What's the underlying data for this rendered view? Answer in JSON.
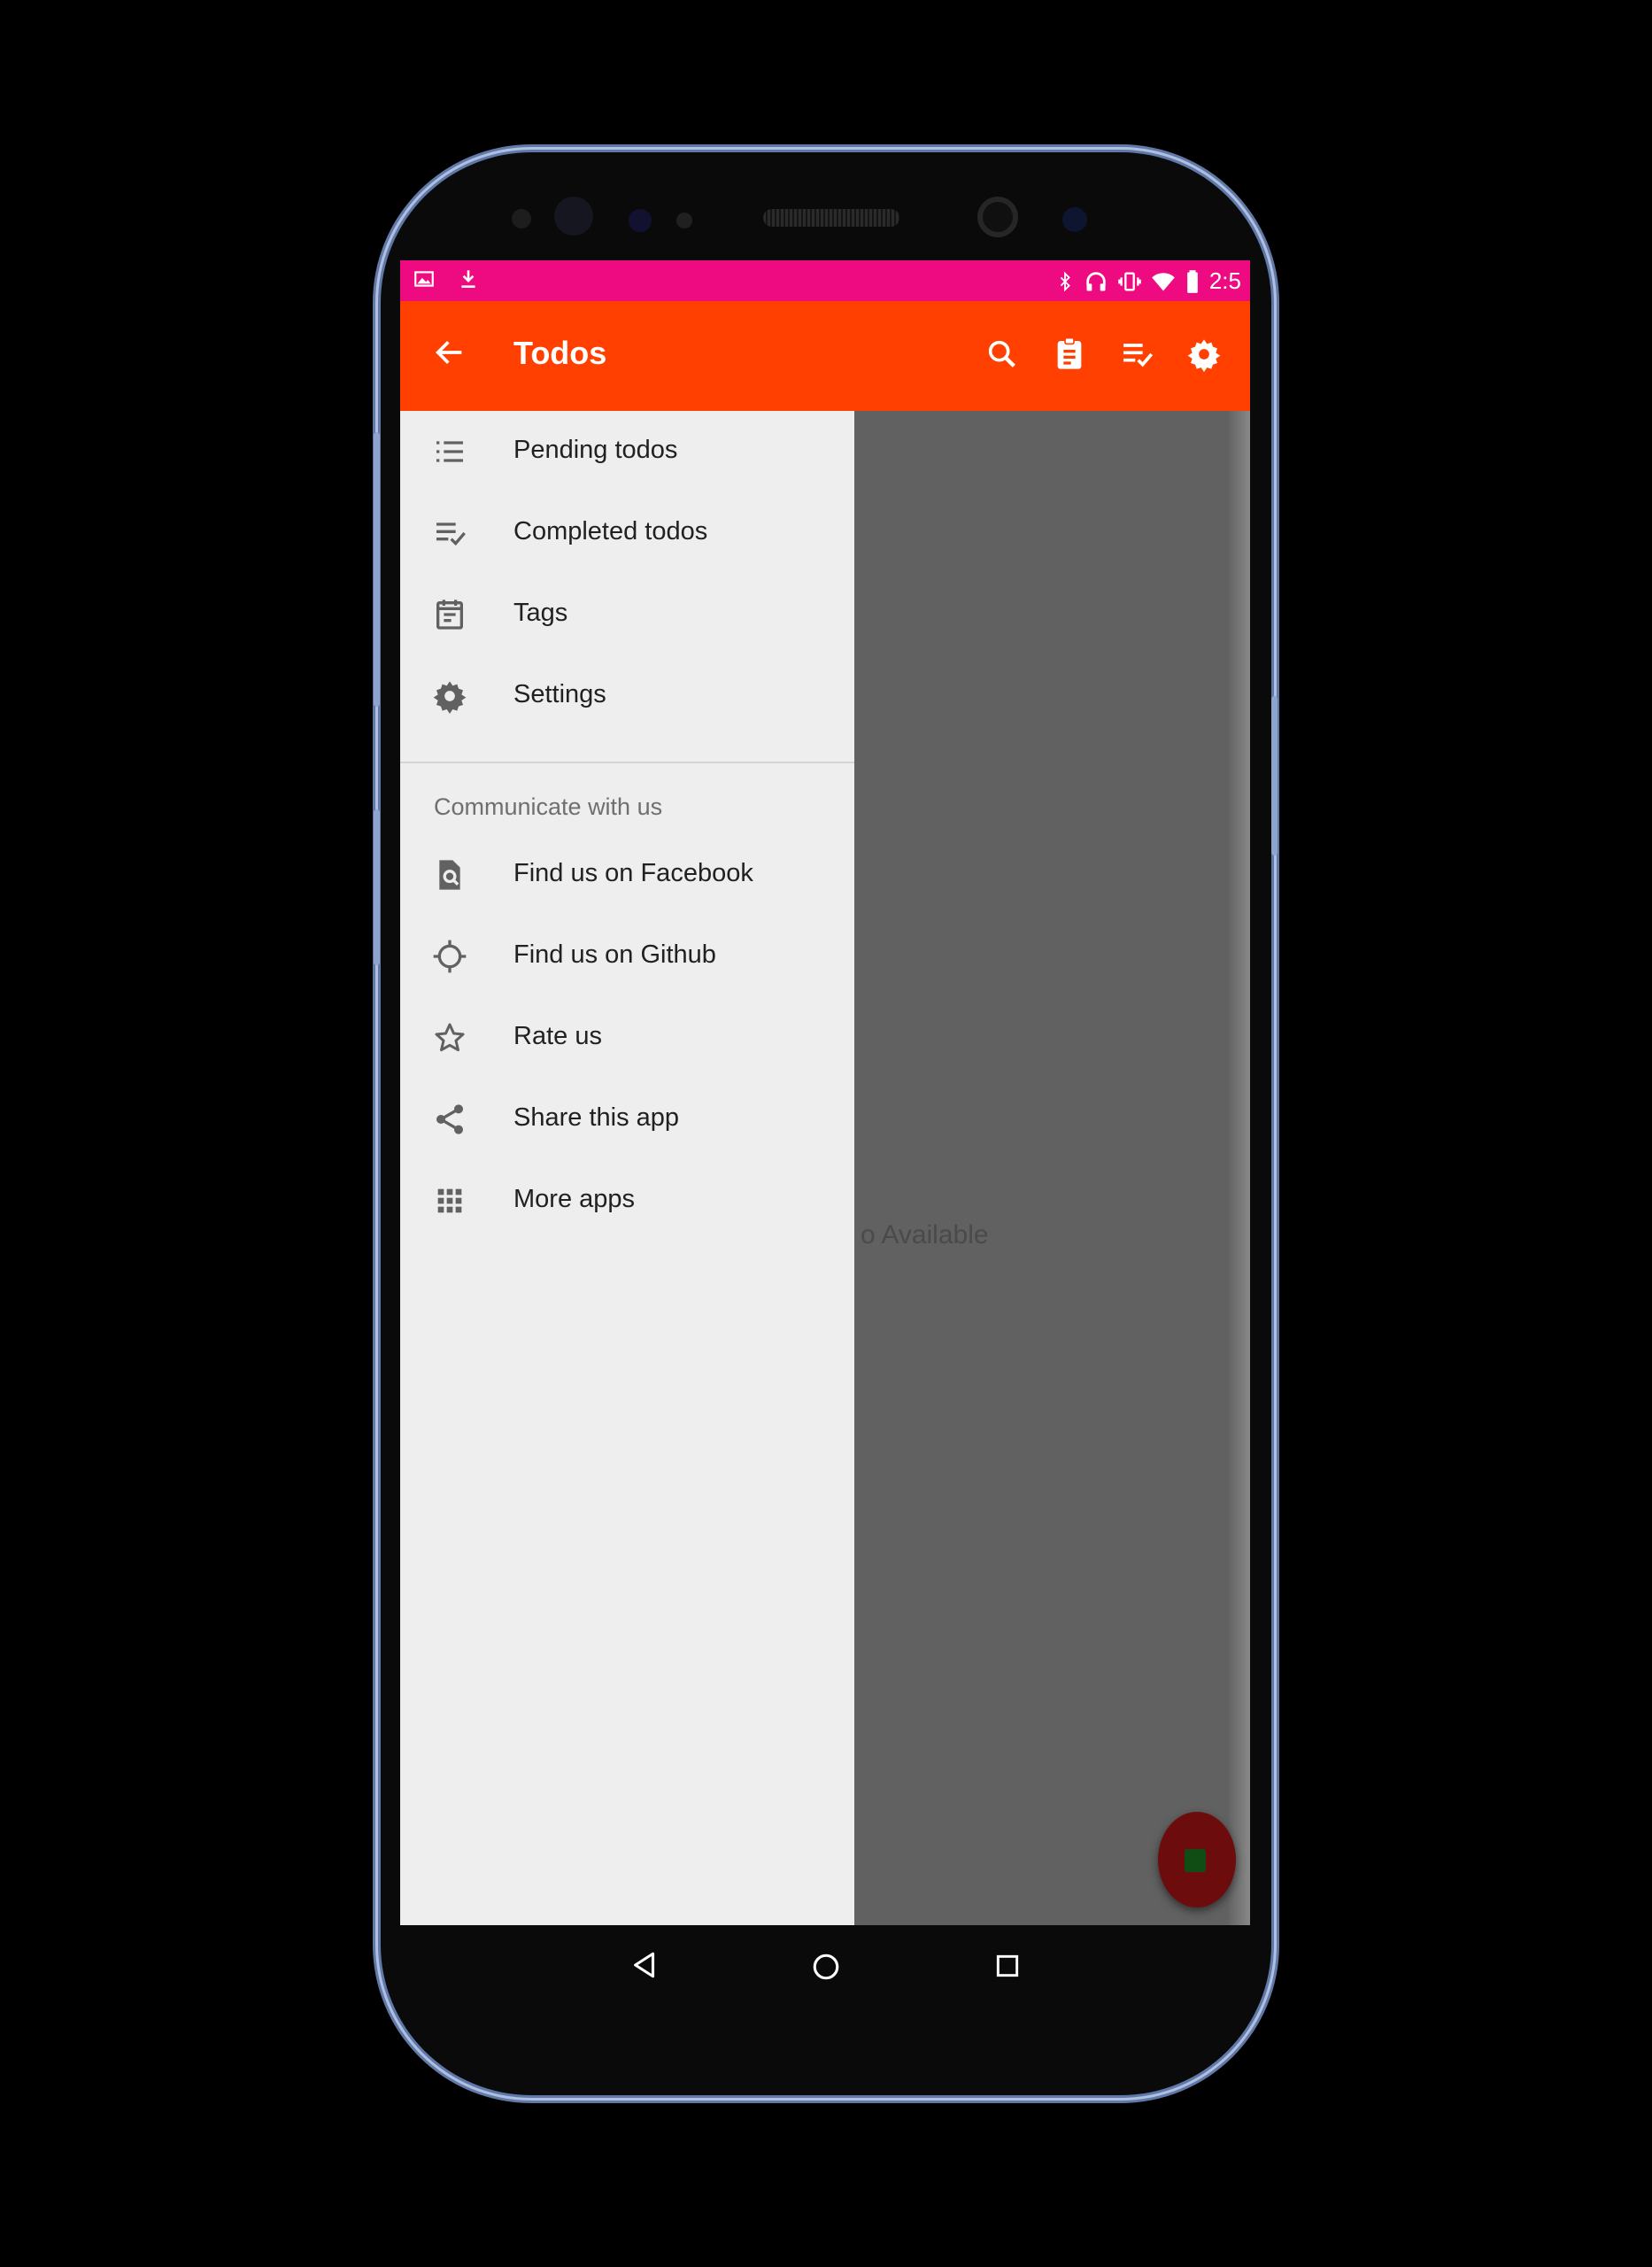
{
  "status_bar": {
    "time": "2:5",
    "left_icons": [
      "image-notification-icon",
      "download-icon"
    ],
    "right_icons": [
      "bluetooth-icon",
      "headset-icon",
      "vibrate-icon",
      "wifi-icon",
      "battery-icon"
    ]
  },
  "app_bar": {
    "title": "Todos",
    "actions": [
      "search-icon",
      "clipboard-icon",
      "playlist-check-icon",
      "settings-icon"
    ]
  },
  "drawer": {
    "primary_items": [
      {
        "label": "Pending todos",
        "icon": "list-icon"
      },
      {
        "label": "Completed todos",
        "icon": "playlist-check-icon"
      },
      {
        "label": "Tags",
        "icon": "calendar-note-icon"
      },
      {
        "label": "Settings",
        "icon": "gear-icon"
      }
    ],
    "subheader": "Communicate with us",
    "secondary_items": [
      {
        "label": "Find us on Facebook",
        "icon": "find-in-page-icon"
      },
      {
        "label": "Find us on Github",
        "icon": "crosshair-icon"
      },
      {
        "label": "Rate us",
        "icon": "star-outline-icon"
      },
      {
        "label": "Share this app",
        "icon": "share-icon"
      },
      {
        "label": "More apps",
        "icon": "apps-grid-icon"
      }
    ]
  },
  "main": {
    "empty_text": "o Available"
  },
  "colors": {
    "status_bar": "#ee0a80",
    "app_bar": "#ff4000",
    "drawer_bg": "#eeeeee",
    "scrim": "#616161",
    "fab": "#6d0c0c"
  }
}
